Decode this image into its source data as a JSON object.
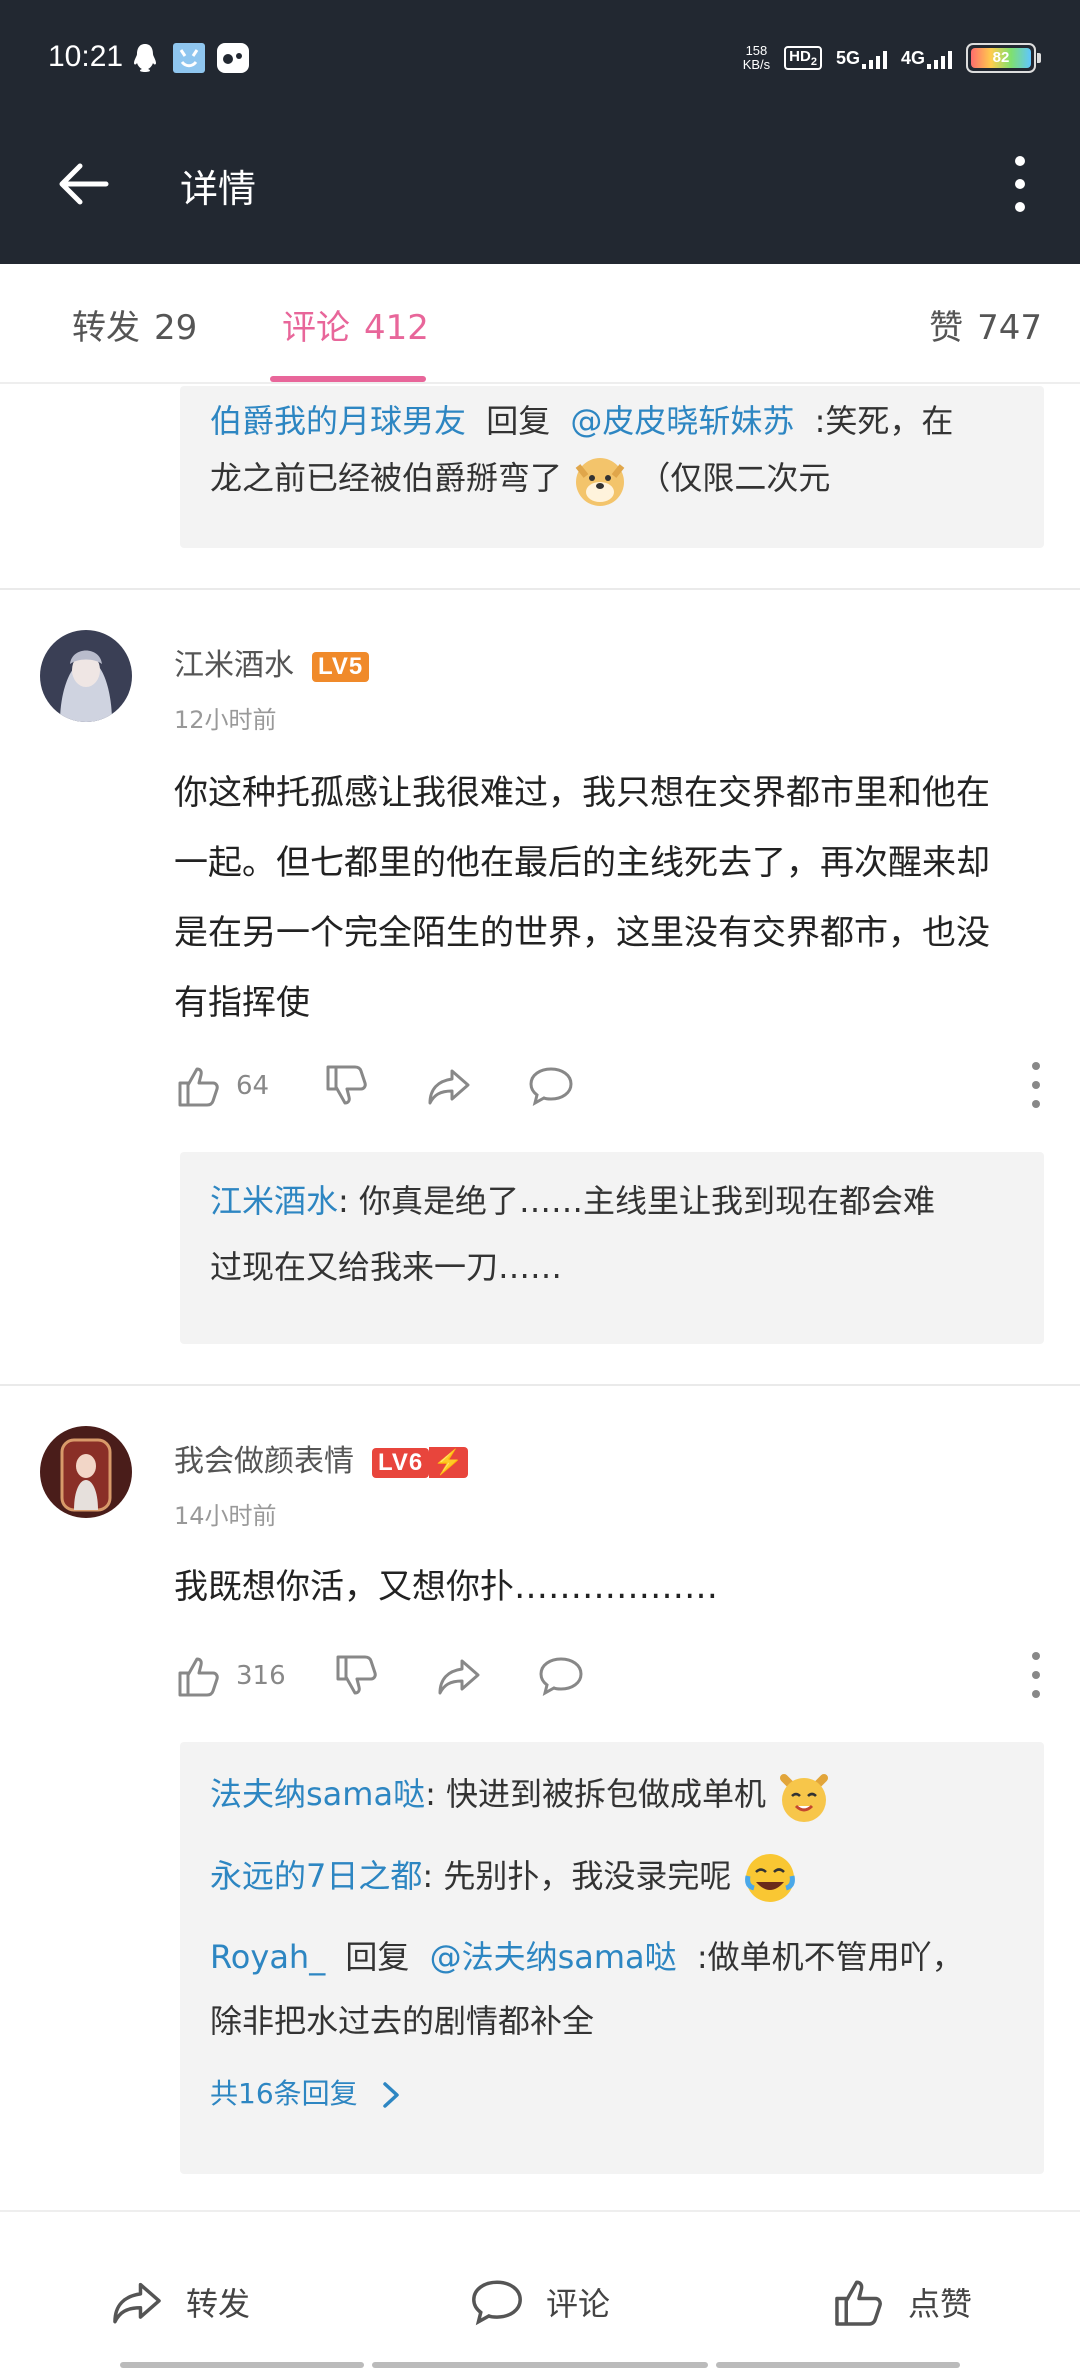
{
  "status_bar": {
    "time": "10:21",
    "net_speed_value": "158",
    "net_speed_unit": "KB/s",
    "hd_label": "HD",
    "hd_sub": "2",
    "sig1_label": "5G",
    "sig2_label": "4G",
    "battery": "82"
  },
  "header": {
    "title": "详情"
  },
  "tabs": [
    {
      "label": "转发",
      "count": "29"
    },
    {
      "label": "评论",
      "count": "412"
    },
    {
      "label": "赞",
      "count": "747"
    }
  ],
  "top_reply": {
    "user": "伯爵我的月球男友",
    "reply_word": "回复",
    "mention": "@皮皮晓斩妹苏",
    "text1": ":笑死，在",
    "text2": "龙之前已经被伯爵掰弯了",
    "text3": "（仅限二次元"
  },
  "comments": [
    {
      "user": "江米酒水",
      "level": "LV5",
      "time": "12小时前",
      "lines": [
        "你这种托孤感让我很难过，我只想在交界都市里和他在",
        "一起。但七都里的他在最后的主线死去了，再次醒来却",
        "是在另一个完全陌生的世界，这里没有交界都市，也没",
        "有指挥使"
      ],
      "likes": "64",
      "reply": {
        "user": "江米酒水",
        "text1": ": 你真是绝了……主线里让我到现在都会难",
        "text2": "过现在又给我来一刀……"
      }
    },
    {
      "user": "我会做颜表情",
      "level": "LV6",
      "time": "14小时前",
      "lines": [
        "我既想你活，又想你扑………………"
      ],
      "likes": "316",
      "replies": [
        {
          "user": "法夫纳sama哒",
          "text": ": 快进到被拆包做成单机"
        },
        {
          "user": "永远的7日之都",
          "text": ": 先别扑，我没录完呢"
        }
      ],
      "reply3": {
        "user": "Royah_",
        "reply_word": "回复",
        "mention": "@法夫纳sama哒",
        "text1": ":做单机不管用吖，",
        "text2": "除非把水过去的剧情都补全"
      },
      "more_replies": "共16条回复"
    }
  ],
  "bottom_bar": {
    "repost": "转发",
    "comment": "评论",
    "like": "点赞"
  },
  "colors": {
    "header_bg": "#222831",
    "accent": "#e8669a",
    "link": "#2d86c2",
    "lv5": "#f08a2a",
    "lv6": "#e8453c"
  }
}
